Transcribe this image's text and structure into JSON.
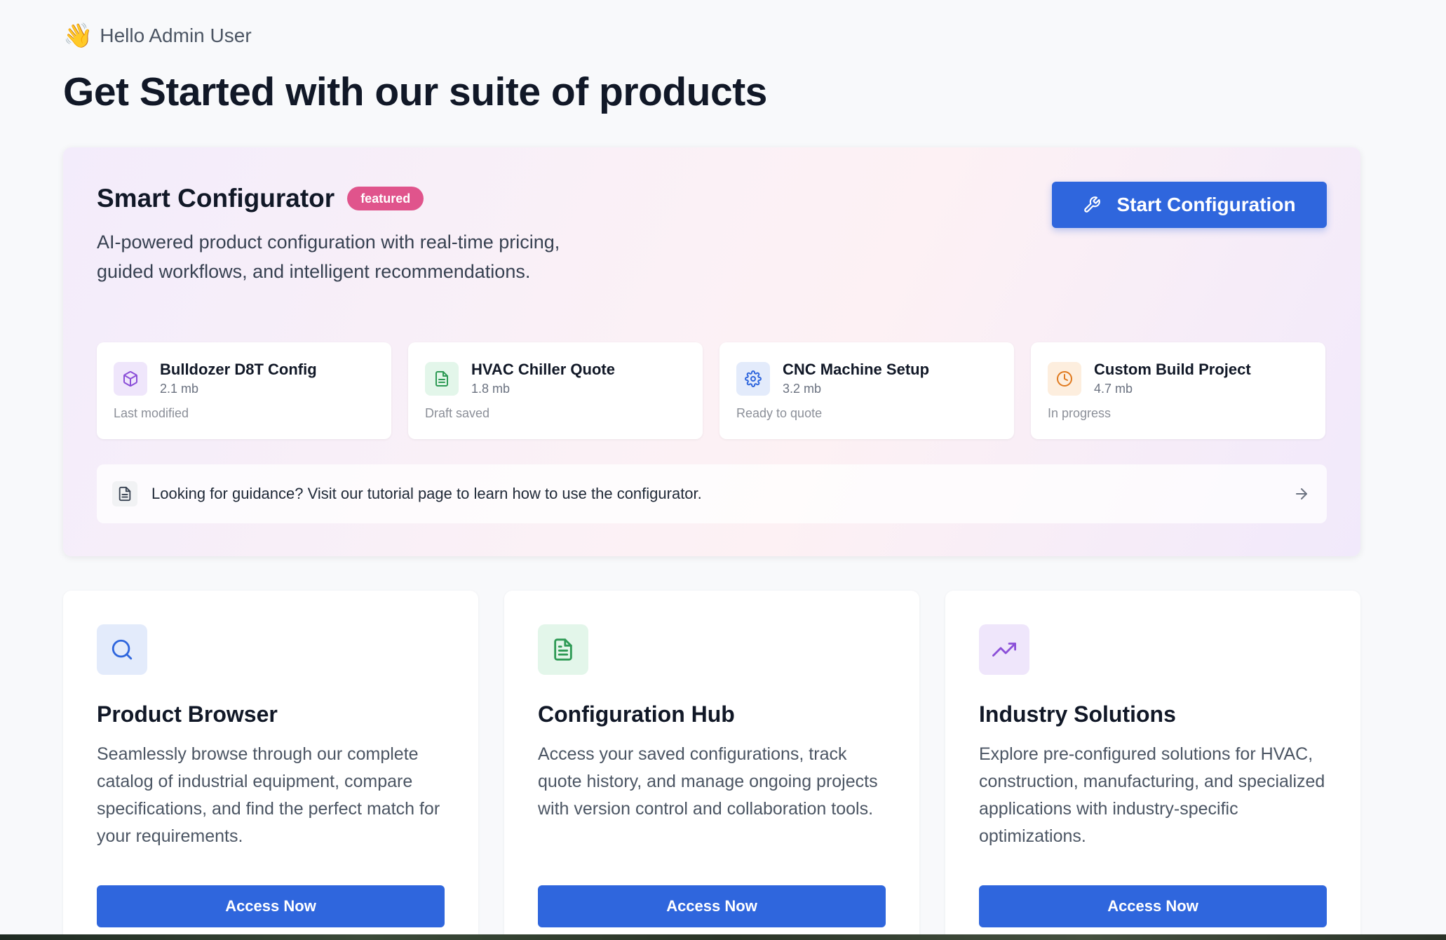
{
  "greeting": {
    "emoji": "👋",
    "text": "Hello Admin User"
  },
  "page_title": "Get Started with our suite of products",
  "featured": {
    "title": "Smart Configurator",
    "badge": "featured",
    "description": "AI-powered product configuration with real-time pricing, guided workflows, and intelligent recommendations.",
    "start_button": "Start Configuration",
    "files": [
      {
        "name": "Bulldozer D8T Config",
        "size": "2.1 mb",
        "status": "Last modified",
        "icon": "cube-icon",
        "icon_color": "#8b4fd8",
        "icon_bg": "#efe6fb"
      },
      {
        "name": "HVAC Chiller Quote",
        "size": "1.8 mb",
        "status": "Draft saved",
        "icon": "document-icon",
        "icon_color": "#2e9a55",
        "icon_bg": "#e3f6ea"
      },
      {
        "name": "CNC Machine Setup",
        "size": "3.2 mb",
        "status": "Ready to quote",
        "icon": "gear-icon",
        "icon_color": "#2f66dd",
        "icon_bg": "#e3ebfb"
      },
      {
        "name": "Custom Build Project",
        "size": "4.7 mb",
        "status": "In progress",
        "icon": "clock-icon",
        "icon_color": "#e07a1f",
        "icon_bg": "#fdeede"
      }
    ],
    "guide_text": "Looking for guidance? Visit our tutorial page to learn how to use the configurator."
  },
  "products": [
    {
      "title": "Product Browser",
      "description": "Seamlessly browse through our complete catalog of industrial equipment, compare specifications, and find the perfect match for your requirements.",
      "button": "Access Now",
      "icon": "search-icon",
      "icon_color": "#2f66dd",
      "icon_bg": "#e3ebfb"
    },
    {
      "title": "Configuration Hub",
      "description": "Access your saved configurations, track quote history, and manage ongoing projects with version control and collaboration tools.",
      "button": "Access Now",
      "icon": "document-icon",
      "icon_color": "#2e9a55",
      "icon_bg": "#e3f6ea"
    },
    {
      "title": "Industry Solutions",
      "description": "Explore pre-configured solutions for HVAC, construction, manufacturing, and specialized applications with industry-specific optimizations.",
      "button": "Access Now",
      "icon": "trending-up-icon",
      "icon_color": "#8b4fd8",
      "icon_bg": "#efe6fb"
    }
  ],
  "colors": {
    "primary": "#2f66dd",
    "badge": "#e0548c"
  }
}
